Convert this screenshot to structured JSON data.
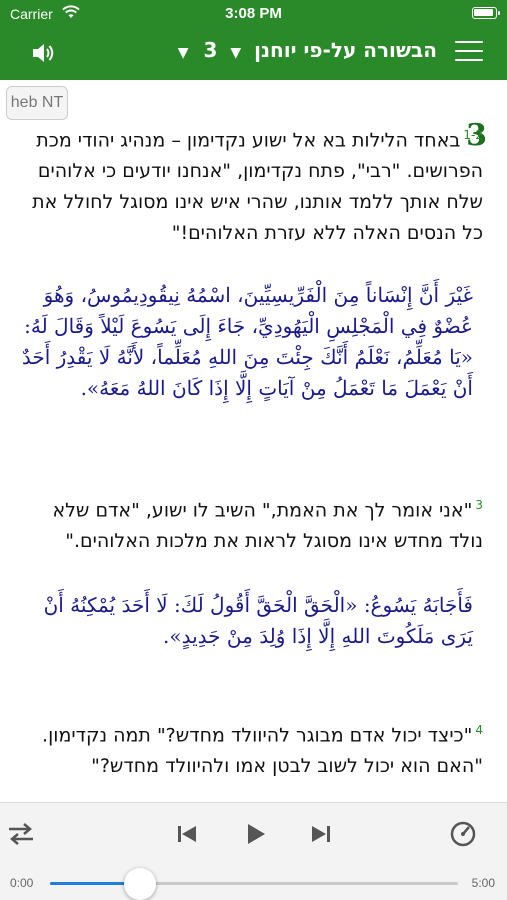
{
  "status": {
    "carrier": "Carrier",
    "time": "3:08 PM"
  },
  "nav": {
    "book_title": "הבשורה על-פי יוחנן",
    "chapter_selector": "3",
    "icons": {
      "left": "speaker-icon",
      "right": "hamburger-menu-icon"
    }
  },
  "content": {
    "version_button": "heb NT",
    "chapter_number": "3",
    "passages": [
      {
        "verse_label": "1-2",
        "hebrew": "באחד הלילות בא אל ישוע נקדימון – מנהיג יהודי מכת הפרושים. \"רבי\", פתח נקדימון, \"אנחנו יודעים כי אלוהים שלח אותך ללמד אותנו, שהרי איש אינו מסוגל לחולל את כל הנסים האלה ללא עזרת האלוהים!\"",
        "arabic": "غَيْرَ أَنَّ إِنْسَاناً مِنَ الْفَرِّيسِيِّينَ، اسْمُهُ نِيقُودِيمُوسُ، وَهُوَ عُضْوٌ فِي الْمَجْلِسِ الْيَهُودِيِّ، جَاءَ إِلَى يَسُوعَ لَيْلاً وَقَالَ لَهُ: «يَا مُعَلِّمُ، نَعْلَمُ أَنَّكَ جِئْتَ مِنَ اللهِ مُعَلِّماً، لأَنَّهُ لَا يَقْدِرُ أَحَدٌ أَنْ يَعْمَلَ مَا تَعْمَلُ مِنْ آيَاتٍ إِلَّا إِذَا كَانَ اللهُ مَعَهُ»."
      },
      {
        "verse_label": "3",
        "hebrew": "\"אני אומר לך את האמת,\" השיב לו ישוע, \"אדם שלא נולד מחדש אינו מסוגל לראות את מלכות האלוהים.\"",
        "arabic": "فَأَجَابَهُ يَسُوعُ: «الْحَقَّ الْحَقَّ أَقُولُ لَكَ: لَا أَحَدَ يُمْكِنُهُ أَنْ يَرَى مَلَكُوتَ اللهِ إِلَّا إِذَا وُلِدَ مِنْ جَدِيدٍ»."
      },
      {
        "verse_label": "4",
        "hebrew": "\"כיצד יכול אדם מבוגר להיוולד מחדש?\" תמה נקדימון. \"האם הוא יכול לשוב לבטן אמו ולהיוולד מחדש?\""
      }
    ]
  },
  "player": {
    "elapsed": "0:00",
    "duration": "5:00",
    "progress_fraction": 0.22,
    "accent_color": "#1e7fe0",
    "icons": [
      "shuffle-icon",
      "previous-track-icon",
      "play-icon",
      "next-track-icon",
      "speed-gauge-icon"
    ]
  },
  "colors": {
    "brand_green": "#2a8a2a",
    "chapter_green": "#1d6e1d",
    "arabic_text": "#1a1a8c"
  }
}
